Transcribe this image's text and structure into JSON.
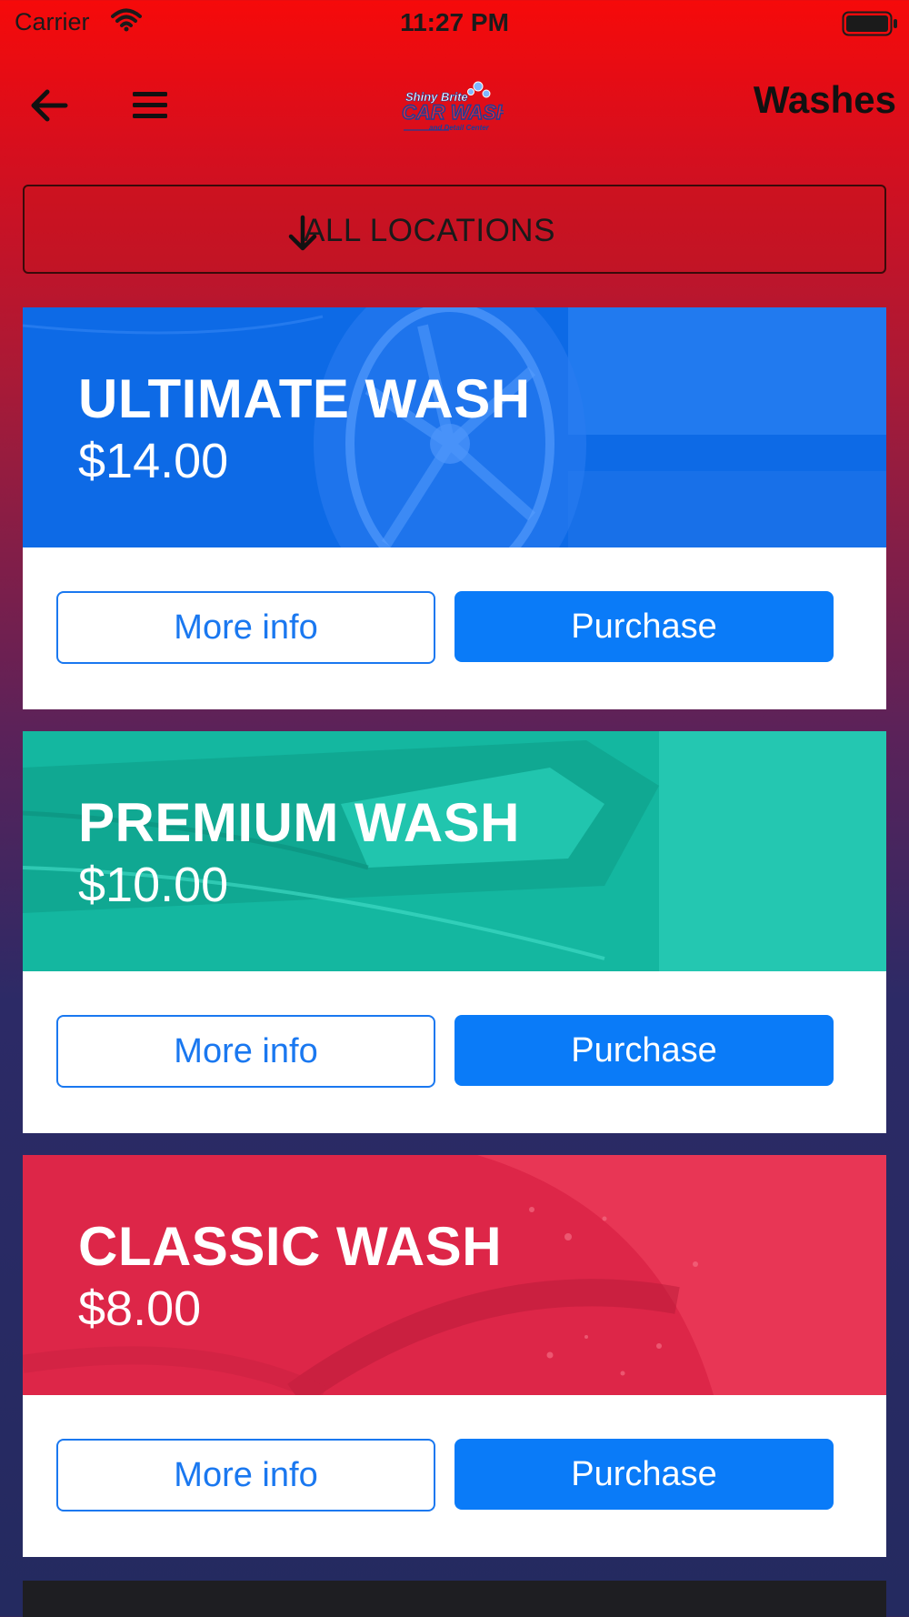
{
  "status_bar": {
    "carrier": "Carrier",
    "time": "11:27 PM"
  },
  "nav": {
    "title": "Washes",
    "logo_text": {
      "line1": "Shiny Brite",
      "line2": "CAR WASH",
      "line3": "and Detail Center"
    }
  },
  "location_selector": {
    "label": "ALL LOCATIONS"
  },
  "washes": [
    {
      "name": "ULTIMATE WASH",
      "price": "$14.00",
      "color": "#0d6ae6",
      "more_info_label": "More info",
      "purchase_label": "Purchase"
    },
    {
      "name": "PREMIUM WASH",
      "price": "$10.00",
      "color": "#14b7a0",
      "more_info_label": "More info",
      "purchase_label": "Purchase"
    },
    {
      "name": "CLASSIC WASH",
      "price": "$8.00",
      "color": "#dd2648",
      "more_info_label": "More info",
      "purchase_label": "Purchase"
    }
  ],
  "colors": {
    "primary_button": "#0a7bf8",
    "header_red": "#f60a0a",
    "background_navy": "#242a60"
  }
}
